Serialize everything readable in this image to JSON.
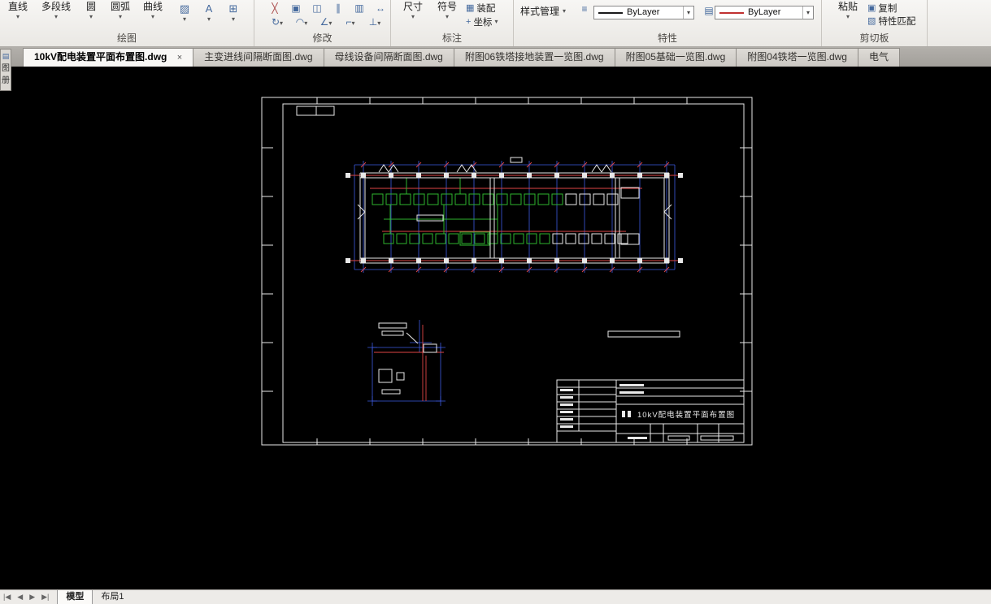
{
  "ribbon": {
    "draw": {
      "label": "绘图",
      "line": "直线",
      "polyline": "多段线",
      "circle": "圆",
      "arc": "圆弧",
      "curve": "曲线"
    },
    "modify": {
      "label": "修改"
    },
    "annotate": {
      "label": "标注",
      "dimension": "尺寸",
      "symbol": "符号",
      "assembly": "装配",
      "coordinate": "坐标"
    },
    "properties": {
      "label": "特性",
      "style_manager": "样式管理",
      "color_value": "ByLayer",
      "linetype_value": "ByLayer",
      "color_swatch": "#1a1a1a",
      "linetype_swatch": "#c03030"
    },
    "clipboard": {
      "label": "剪切板",
      "paste": "粘贴",
      "copy": "复制",
      "match": "特性匹配"
    }
  },
  "document_tabs": [
    {
      "title": "10kV配电装置平面布置图.dwg",
      "active": true
    },
    {
      "title": "主变进线间隔断面图.dwg",
      "active": false
    },
    {
      "title": "母线设备间隔断面图.dwg",
      "active": false
    },
    {
      "title": "附图06铁塔接地装置一览图.dwg",
      "active": false
    },
    {
      "title": "附图05基础一览图.dwg",
      "active": false
    },
    {
      "title": "附图04铁塔一览图.dwg",
      "active": false
    },
    {
      "title": "电气",
      "active": false
    }
  ],
  "side_tabs": {
    "char1": "图",
    "char2": "册"
  },
  "drawing": {
    "title_block_title": "10kV配电装置平面布置图",
    "colors": {
      "white": "#e8e8e8",
      "red": "#de4545",
      "green": "#2eb52e",
      "blue": "#3d5ae0"
    },
    "canvas_background": "#000000"
  },
  "bottom": {
    "model": "模型",
    "layout": "布局1"
  },
  "icons": {
    "dropdown": "▾",
    "close": "×",
    "hatch": "▨",
    "text_style": "A",
    "grid": "⊞",
    "menu": "≡",
    "layers": "▤",
    "erase": "╳",
    "copy": "▣",
    "mirror": "◫",
    "offset": "∥",
    "array": "▥",
    "move": "↔",
    "rotate": "↻",
    "fillet": "◠",
    "chamfer": "∠",
    "trim": "⌐",
    "extend": "⊥",
    "coordinate": "+",
    "assembly": "▦",
    "match": "▧",
    "nav_first": "|◀",
    "nav_prev": "◀",
    "nav_next": "▶",
    "nav_last": "▶|"
  }
}
